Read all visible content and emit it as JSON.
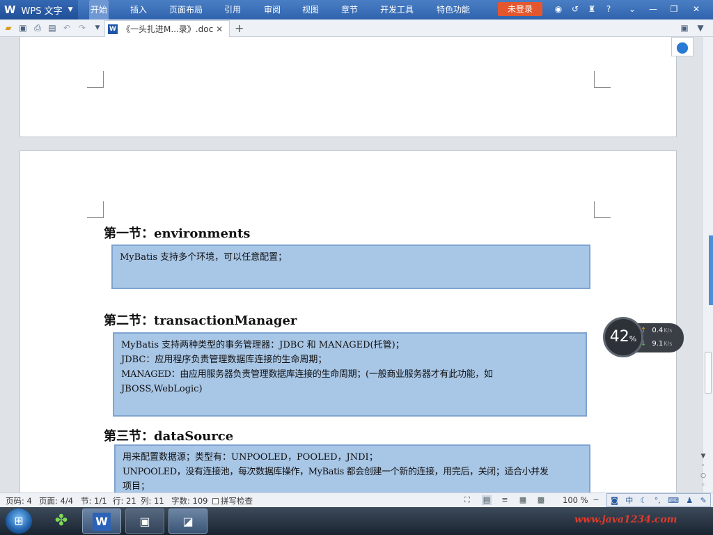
{
  "app": {
    "name": "WPS 文字",
    "logo": "W",
    "login_label": "未登录"
  },
  "menu": {
    "items": [
      "开始",
      "插入",
      "页面布局",
      "引用",
      "审阅",
      "视图",
      "章节",
      "开发工具",
      "特色功能"
    ],
    "active": "开始"
  },
  "tab": {
    "label": "《一头扎进M...录》.doc",
    "icon": "W"
  },
  "sections": [
    {
      "title": "第一节：environments",
      "lines": [
        "MyBatis 支持多个环境，可以任意配置；"
      ]
    },
    {
      "title": "第二节：transactionManager",
      "lines": [
        "MyBatis 支持两种类型的事务管理器：JDBC 和 MANAGED(托管)；",
        "JDBC：应用程序负责管理数据库连接的生命周期；",
        "MANAGED：由应用服务器负责管理数据库连接的生命周期；(一般商业服务器才有此功能，如",
        "JBOSS,WebLogic)"
      ]
    },
    {
      "title": "第三节：dataSource",
      "lines": [
        "用来配置数据源；类型有：UNPOOLED，POOLED，JNDI；",
        "UNPOOLED，没有连接池，每次数据库操作，MyBatis 都会创建一个新的连接，用完后，关闭；适合小并发",
        "项目；"
      ]
    }
  ],
  "speed": {
    "percent": "42",
    "pct_sign": "%",
    "up": "0.4",
    "down": "9.1",
    "unit": "K/s"
  },
  "status": {
    "page_code": "页码: 4",
    "pages": "页面: 4/4",
    "section": "节: 1/1",
    "row": "行: 21",
    "col": "列: 11",
    "word_count": "字数: 109",
    "spell_check": "拼写检查",
    "zoom": "100 %"
  },
  "ime": {
    "lang": "中"
  },
  "taskbar": {
    "watermark": "www.java1234.com"
  },
  "colors": {
    "title_bar": "#2f63ad",
    "box_fill": "#a8c6e6",
    "box_border": "#7ea3cf",
    "login_button": "#e4572e"
  }
}
